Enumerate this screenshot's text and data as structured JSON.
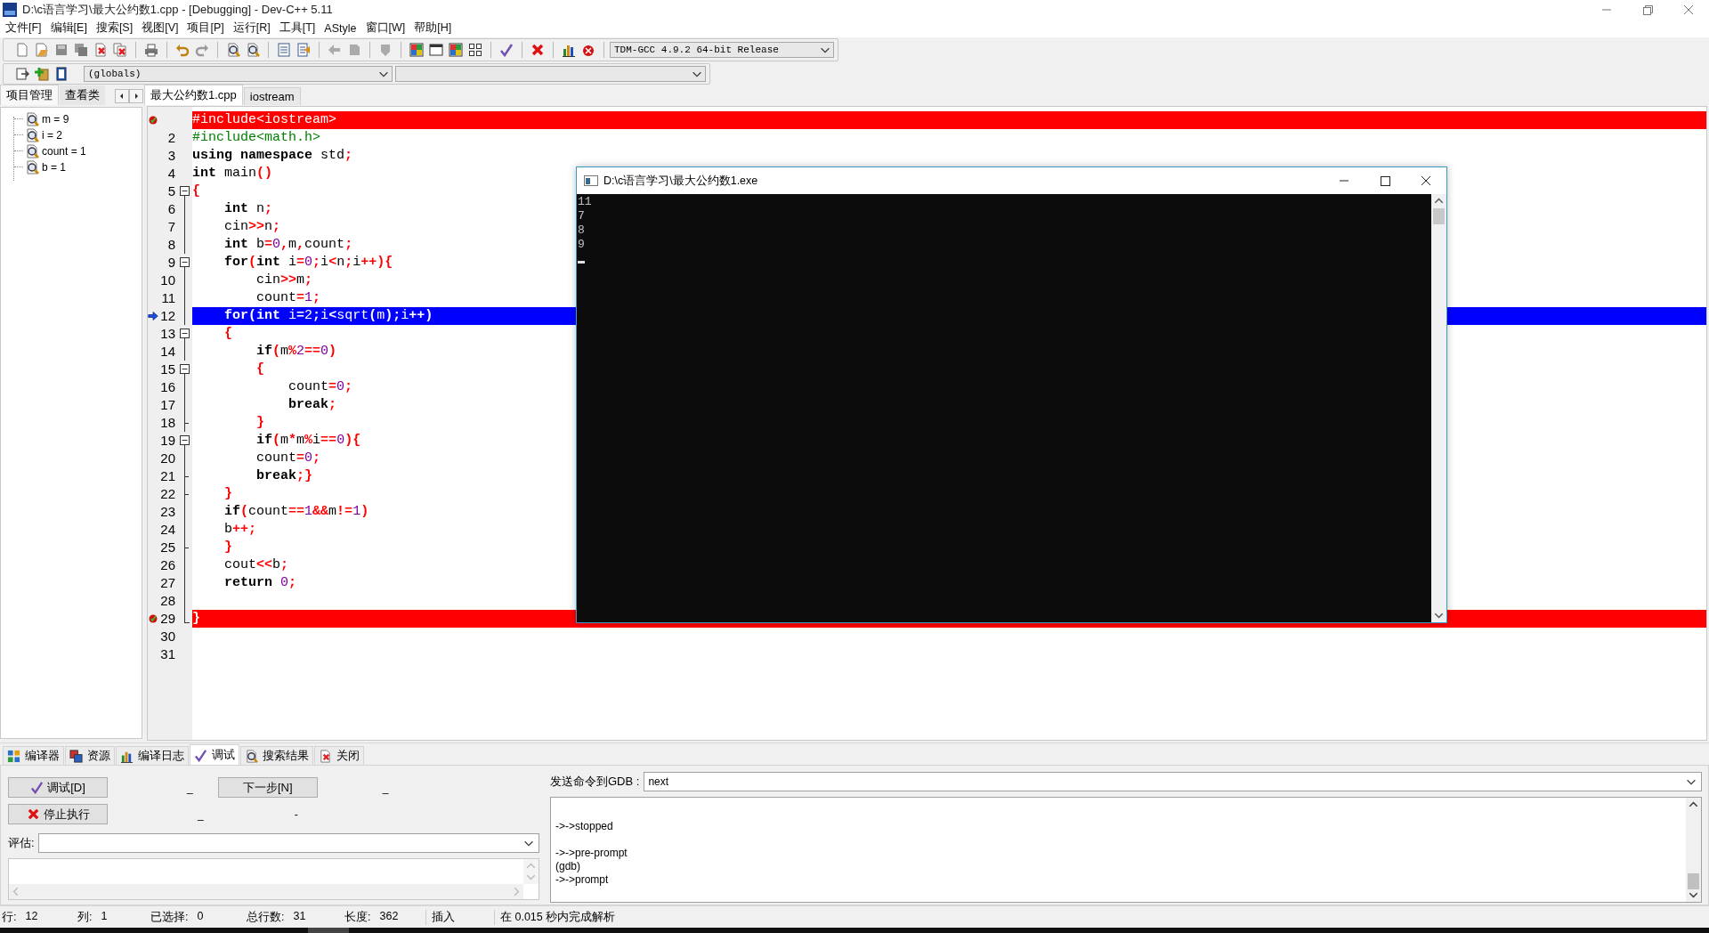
{
  "window": {
    "title": "D:\\c语言学习\\最大公约数1.cpp - [Debugging] - Dev-C++ 5.11"
  },
  "menu": [
    "文件[F]",
    "编辑[E]",
    "搜索[S]",
    "视图[V]",
    "项目[P]",
    "运行[R]",
    "工具[T]",
    "AStyle",
    "窗口[W]",
    "帮助[H]"
  ],
  "toolbar": {
    "compiler": "TDM-GCC 4.9.2 64-bit Release",
    "scope": "(globals)"
  },
  "side_panel": {
    "tabs": [
      {
        "label": "项目管理",
        "selected": true
      },
      {
        "label": "查看类",
        "selected": false
      }
    ],
    "watches": [
      {
        "label": "m = 9"
      },
      {
        "label": "i = 2"
      },
      {
        "label": "count = 1"
      },
      {
        "label": "b = 1"
      }
    ]
  },
  "editor": {
    "tabs": [
      {
        "label": "最大公约数1.cpp",
        "selected": true
      },
      {
        "label": "iostream",
        "selected": false
      }
    ],
    "lines": [
      {
        "breakpoint": true,
        "tokens": [
          {
            "kind": "pp",
            "text": "#include<iostream>"
          }
        ]
      },
      {
        "number": "2",
        "tokens": [
          {
            "kind": "pp",
            "text": "#include<math.h>"
          }
        ]
      },
      {
        "number": "3",
        "tokens": [
          {
            "kind": "kw",
            "text": "using"
          },
          {
            "kind": "kw",
            "text": " namespace"
          },
          {
            "kind": "id",
            "text": " std"
          },
          {
            "kind": "op",
            "text": ";"
          }
        ]
      },
      {
        "number": "4",
        "tokens": [
          {
            "kind": "kw",
            "text": "int"
          },
          {
            "kind": "id",
            "text": " main"
          },
          {
            "kind": "op",
            "text": "()"
          }
        ]
      },
      {
        "number": "5",
        "fold_start": true,
        "tokens": [
          {
            "kind": "op",
            "text": "{"
          }
        ]
      },
      {
        "number": "6",
        "tokens": [
          {
            "kind": "kw",
            "text": "    int"
          },
          {
            "kind": "id",
            "text": " n"
          },
          {
            "kind": "op",
            "text": ";"
          }
        ]
      },
      {
        "number": "7",
        "tokens": [
          {
            "kind": "id",
            "text": "    cin"
          },
          {
            "kind": "op",
            "text": ">>"
          },
          {
            "kind": "id",
            "text": "n"
          },
          {
            "kind": "op",
            "text": ";"
          }
        ]
      },
      {
        "number": "8",
        "tokens": [
          {
            "kind": "kw",
            "text": "    int"
          },
          {
            "kind": "id",
            "text": " b"
          },
          {
            "kind": "op",
            "text": "="
          },
          {
            "kind": "num",
            "text": "0"
          },
          {
            "kind": "op",
            "text": ","
          },
          {
            "kind": "id",
            "text": "m"
          },
          {
            "kind": "op",
            "text": ","
          },
          {
            "kind": "id",
            "text": "count"
          },
          {
            "kind": "op",
            "text": ";"
          }
        ]
      },
      {
        "number": "9",
        "fold_start": true,
        "tokens": [
          {
            "kind": "kw",
            "text": "    for"
          },
          {
            "kind": "op",
            "text": "("
          },
          {
            "kind": "kw",
            "text": "int"
          },
          {
            "kind": "id",
            "text": " i"
          },
          {
            "kind": "op",
            "text": "="
          },
          {
            "kind": "num",
            "text": "0"
          },
          {
            "kind": "op",
            "text": ";"
          },
          {
            "kind": "id",
            "text": "i"
          },
          {
            "kind": "op",
            "text": "<"
          },
          {
            "kind": "id",
            "text": "n"
          },
          {
            "kind": "op",
            "text": ";"
          },
          {
            "kind": "id",
            "text": "i"
          },
          {
            "kind": "op",
            "text": "++){"
          }
        ]
      },
      {
        "number": "10",
        "tokens": [
          {
            "kind": "id",
            "text": "        cin"
          },
          {
            "kind": "op",
            "text": ">>"
          },
          {
            "kind": "id",
            "text": "m"
          },
          {
            "kind": "op",
            "text": ";"
          }
        ]
      },
      {
        "number": "11",
        "tokens": [
          {
            "kind": "id",
            "text": "        count"
          },
          {
            "kind": "op",
            "text": "="
          },
          {
            "kind": "num",
            "text": "1"
          },
          {
            "kind": "op",
            "text": ";"
          }
        ]
      },
      {
        "number": "12",
        "current": true,
        "tokens": [
          {
            "kind": "kw",
            "text": "    for"
          },
          {
            "kind": "op",
            "text": "("
          },
          {
            "kind": "kw",
            "text": "int"
          },
          {
            "kind": "id",
            "text": " i"
          },
          {
            "kind": "op",
            "text": "="
          },
          {
            "kind": "num",
            "text": "2"
          },
          {
            "kind": "op",
            "text": ";"
          },
          {
            "kind": "id",
            "text": "i"
          },
          {
            "kind": "op",
            "text": "<"
          },
          {
            "kind": "id",
            "text": "sqrt"
          },
          {
            "kind": "op",
            "text": "("
          },
          {
            "kind": "id",
            "text": "m"
          },
          {
            "kind": "op",
            "text": ");"
          },
          {
            "kind": "id",
            "text": "i"
          },
          {
            "kind": "op",
            "text": "++)"
          }
        ]
      },
      {
        "number": "13",
        "fold_start": true,
        "tokens": [
          {
            "kind": "op",
            "text": "    {"
          }
        ]
      },
      {
        "number": "14",
        "tokens": [
          {
            "kind": "kw",
            "text": "        if"
          },
          {
            "kind": "op",
            "text": "("
          },
          {
            "kind": "id",
            "text": "m"
          },
          {
            "kind": "op",
            "text": "%"
          },
          {
            "kind": "num",
            "text": "2"
          },
          {
            "kind": "op",
            "text": "=="
          },
          {
            "kind": "num",
            "text": "0"
          },
          {
            "kind": "op",
            "text": ")"
          }
        ]
      },
      {
        "number": "15",
        "fold_start": true,
        "tokens": [
          {
            "kind": "op",
            "text": "        {"
          }
        ]
      },
      {
        "number": "16",
        "tokens": [
          {
            "kind": "id",
            "text": "            count"
          },
          {
            "kind": "op",
            "text": "="
          },
          {
            "kind": "num",
            "text": "0"
          },
          {
            "kind": "op",
            "text": ";"
          }
        ]
      },
      {
        "number": "17",
        "tokens": [
          {
            "kind": "kw",
            "text": "            break"
          },
          {
            "kind": "op",
            "text": ";"
          }
        ]
      },
      {
        "number": "18",
        "fold_end": true,
        "tokens": [
          {
            "kind": "op",
            "text": "        }"
          }
        ]
      },
      {
        "number": "19",
        "fold_start": true,
        "tokens": [
          {
            "kind": "kw",
            "text": "        if"
          },
          {
            "kind": "op",
            "text": "("
          },
          {
            "kind": "id",
            "text": "m"
          },
          {
            "kind": "op",
            "text": "*"
          },
          {
            "kind": "id",
            "text": "m"
          },
          {
            "kind": "op",
            "text": "%"
          },
          {
            "kind": "id",
            "text": "i"
          },
          {
            "kind": "op",
            "text": "=="
          },
          {
            "kind": "num",
            "text": "0"
          },
          {
            "kind": "op",
            "text": "){"
          }
        ]
      },
      {
        "number": "20",
        "tokens": [
          {
            "kind": "id",
            "text": "        count"
          },
          {
            "kind": "op",
            "text": "="
          },
          {
            "kind": "num",
            "text": "0"
          },
          {
            "kind": "op",
            "text": ";"
          }
        ]
      },
      {
        "number": "21",
        "fold_end": true,
        "tokens": [
          {
            "kind": "kw",
            "text": "        break"
          },
          {
            "kind": "op",
            "text": ";}"
          }
        ]
      },
      {
        "number": "22",
        "fold_end": true,
        "tokens": [
          {
            "kind": "op",
            "text": "    }"
          }
        ]
      },
      {
        "number": "23",
        "tokens": [
          {
            "kind": "kw",
            "text": "    if"
          },
          {
            "kind": "op",
            "text": "("
          },
          {
            "kind": "id",
            "text": "count"
          },
          {
            "kind": "op",
            "text": "=="
          },
          {
            "kind": "num",
            "text": "1"
          },
          {
            "kind": "op",
            "text": "&&"
          },
          {
            "kind": "id",
            "text": "m"
          },
          {
            "kind": "op",
            "text": "!="
          },
          {
            "kind": "num",
            "text": "1"
          },
          {
            "kind": "op",
            "text": ")"
          }
        ]
      },
      {
        "number": "24",
        "tokens": [
          {
            "kind": "id",
            "text": "    b"
          },
          {
            "kind": "op",
            "text": "++;"
          }
        ]
      },
      {
        "number": "25",
        "fold_end": true,
        "tokens": [
          {
            "kind": "op",
            "text": "    }"
          }
        ]
      },
      {
        "number": "26",
        "tokens": [
          {
            "kind": "id",
            "text": "    cout"
          },
          {
            "kind": "op",
            "text": "<<"
          },
          {
            "kind": "id",
            "text": "b"
          },
          {
            "kind": "op",
            "text": ";"
          }
        ]
      },
      {
        "number": "27",
        "tokens": [
          {
            "kind": "kw",
            "text": "    return"
          },
          {
            "kind": "num",
            "text": " 0"
          },
          {
            "kind": "op",
            "text": ";"
          }
        ]
      },
      {
        "number": "28"
      },
      {
        "number": "29",
        "fold_end": true,
        "breakpoint": true,
        "tokens": [
          {
            "kind": "op",
            "text": "}"
          }
        ]
      },
      {
        "number": "30"
      },
      {
        "number": "31"
      }
    ]
  },
  "console": {
    "title": "D:\\c语言学习\\最大公约数1.exe",
    "output": [
      "11",
      "7",
      "8",
      "9"
    ]
  },
  "bottom_tabs": [
    {
      "label": "编译器",
      "selected": false
    },
    {
      "label": "资源",
      "selected": false
    },
    {
      "label": "编译日志",
      "selected": false
    },
    {
      "label": "调试",
      "selected": true
    },
    {
      "label": "搜索结果",
      "selected": false
    },
    {
      "label": "关闭",
      "selected": false
    }
  ],
  "debug": {
    "debug_button": "调试[D]",
    "next_button": "下一步[N]",
    "stop_button": "停止执行",
    "marks": [
      "_",
      "_",
      "_",
      "-"
    ],
    "evaluate_label": "评估:",
    "gdb_label": "发送命令到GDB :",
    "gdb_command": "next",
    "gdb_log": [
      [
        "->->stopped"
      ],
      [
        "->->pre-prompt",
        "(gdb)",
        "->->prompt"
      ]
    ]
  },
  "status_bar": {
    "fields": [
      {
        "label": "行:",
        "value": "12"
      },
      {
        "label": "列:",
        "value": "1"
      },
      {
        "label": "已选择:",
        "value": "0"
      },
      {
        "label": "总行数:",
        "value": "31"
      },
      {
        "label": "长度:",
        "value": "362"
      }
    ],
    "mode": "插入",
    "message": "在 0.015 秒内完成解析"
  }
}
